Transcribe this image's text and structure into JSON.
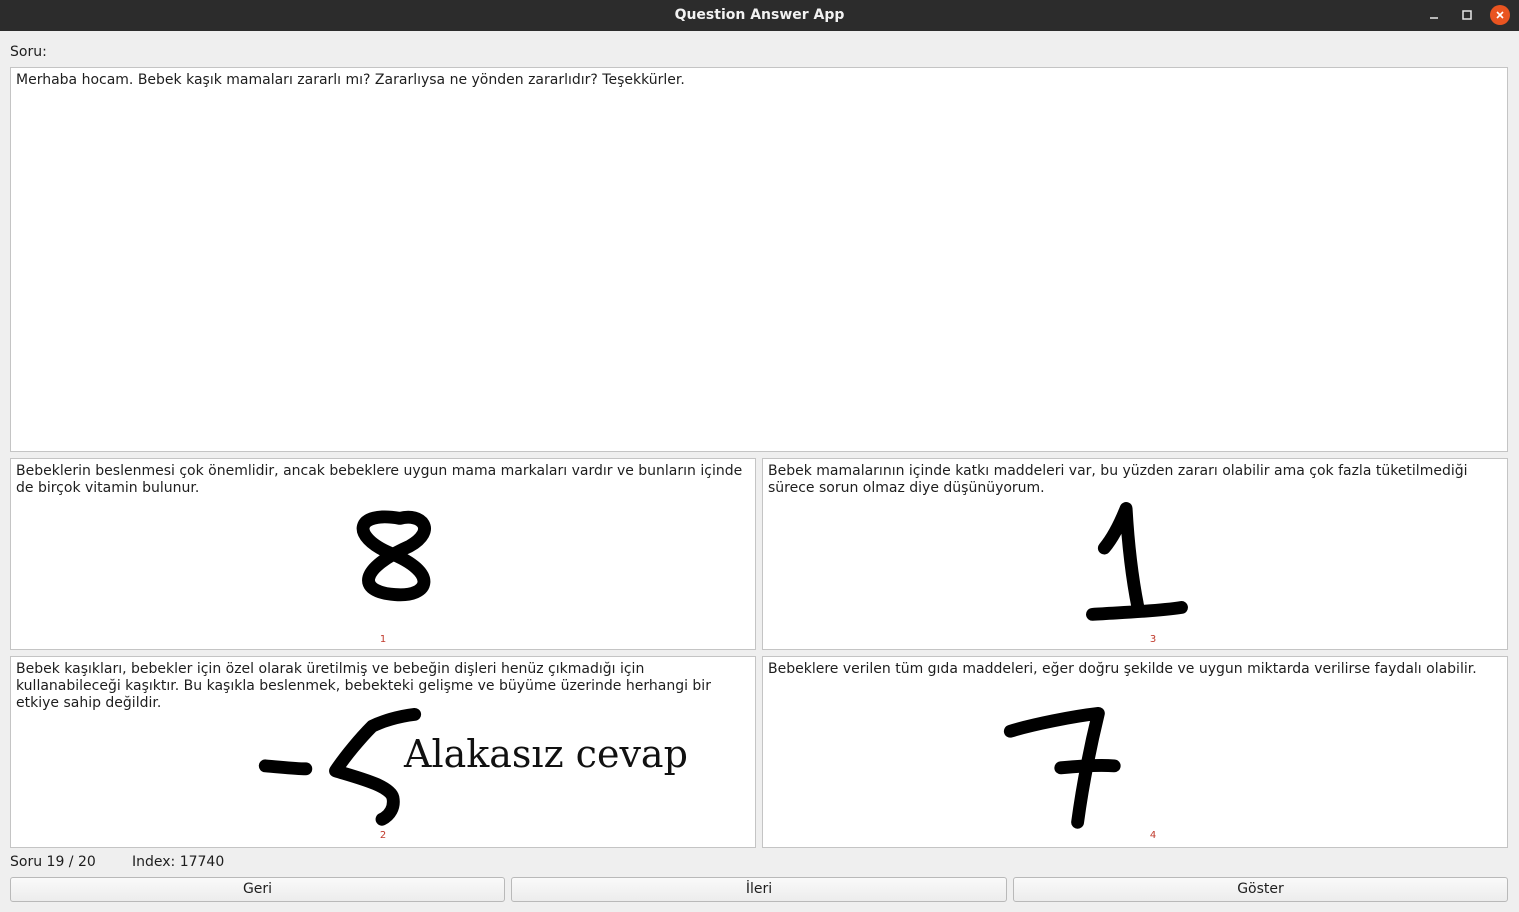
{
  "window": {
    "title": "Question Answer App"
  },
  "question": {
    "label": "Soru:",
    "text": "Merhaba hocam. Bebek kaşık mamaları zararlı mı? Zararlıysa ne yönden zararlıdır? Teşekkürler."
  },
  "answers": [
    {
      "text": "Bebeklerin beslenmesi çok önemlidir, ancak bebeklere uygun mama markaları vardır ve bunların içinde de birçok vitamin bulunur.",
      "index_label": "1",
      "handwritten_score": "8"
    },
    {
      "text": "Bebek mamalarının içinde katkı maddeleri var, bu yüzden zararı olabilir ama çok fazla tüketilmediği sürece sorun olmaz diye düşünüyorum.",
      "index_label": "3",
      "handwritten_score": "1"
    },
    {
      "text": "Bebek kaşıkları, bebekler için özel olarak üretilmiş ve bebeğin dişleri henüz çıkmadığı için kullanabileceği kaşıktır. Bu kaşıkla beslenmek, bebekteki gelişme ve büyüme üzerinde herhangi bir etkiye sahip değildir.",
      "index_label": "2",
      "handwritten_score": "-5",
      "annotation": "Alakasız cevap"
    },
    {
      "text": "Bebeklere verilen tüm gıda maddeleri, eğer doğru şekilde ve uygun miktarda verilirse faydalı olabilir.",
      "index_label": "4",
      "handwritten_score": "7"
    }
  ],
  "status": {
    "progress": "Soru 19 / 20",
    "index": "Index: 17740"
  },
  "buttons": {
    "back": "Geri",
    "next": "İleri",
    "show": "Göster"
  },
  "colors": {
    "titlebar": "#2c2c2c",
    "close_button": "#e95420",
    "index_label": "#c0392b"
  },
  "icons": [
    "minimize-icon",
    "maximize-icon",
    "close-icon"
  ]
}
